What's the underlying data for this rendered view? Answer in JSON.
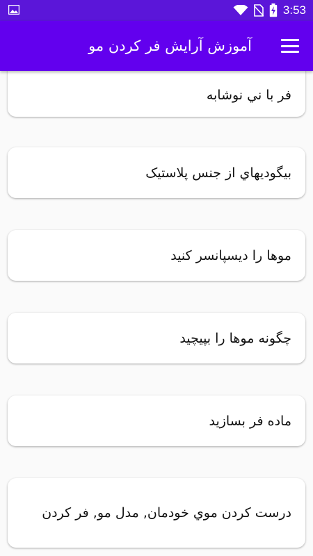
{
  "status_bar": {
    "time": "3:53",
    "icons": [
      "image-icon",
      "wifi-icon",
      "no-sim-icon",
      "battery-charging-icon"
    ]
  },
  "app_bar": {
    "title": "آموزش آرایش فر کردن مو",
    "menu_icon": "hamburger-menu-icon"
  },
  "items": [
    {
      "label": "فر با ني نوشابه"
    },
    {
      "label": "بيگوديهاي از جنس پلاستيک"
    },
    {
      "label": "موها را ديسپانسر کنيد"
    },
    {
      "label": "چگونه موها را بپيچيد"
    },
    {
      "label": "ماده فر بسازيد"
    },
    {
      "label": "درست کردن موي خودمان, مدل مو, فر کردن"
    }
  ],
  "colors": {
    "status_bar": "#5b16d9",
    "app_bar": "#6200ee",
    "background": "#fafafa",
    "card": "#ffffff"
  }
}
